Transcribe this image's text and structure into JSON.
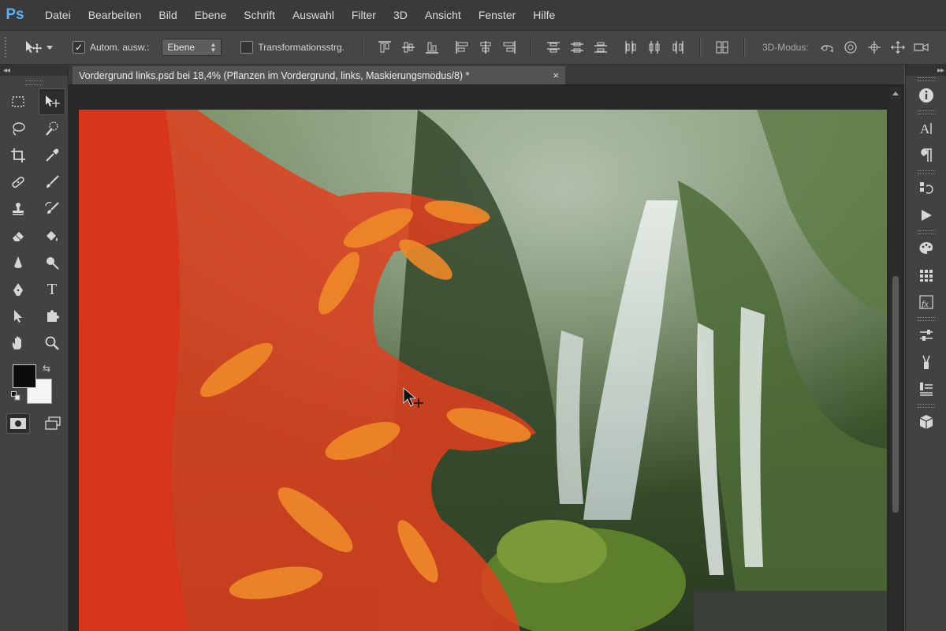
{
  "app": {
    "logo": "Ps"
  },
  "menu": [
    "Datei",
    "Bearbeiten",
    "Bild",
    "Ebene",
    "Schrift",
    "Auswahl",
    "Filter",
    "3D",
    "Ansicht",
    "Fenster",
    "Hilfe"
  ],
  "options": {
    "auto_select_label": "Autom. ausw.:",
    "auto_select_checked": true,
    "auto_select_value": "Ebene",
    "transform_label": "Transformationsstrg.",
    "transform_checked": false,
    "mode_label": "3D-Modus:"
  },
  "toolbox": {
    "collapse_label": "◂◂"
  },
  "dock": {
    "collapse_label": "▸▸"
  },
  "document": {
    "tab_title": "Vordergrund links.psd bei 18,4% (Pflanzen im Vordergrund, links, Maskierungsmodus/8) *",
    "close_label": "×"
  },
  "colors": {
    "foreground": "#0c0c0c",
    "background": "#f4f4f4",
    "mask_overlay": "#e0401e",
    "accent": "#5ab1f4"
  }
}
